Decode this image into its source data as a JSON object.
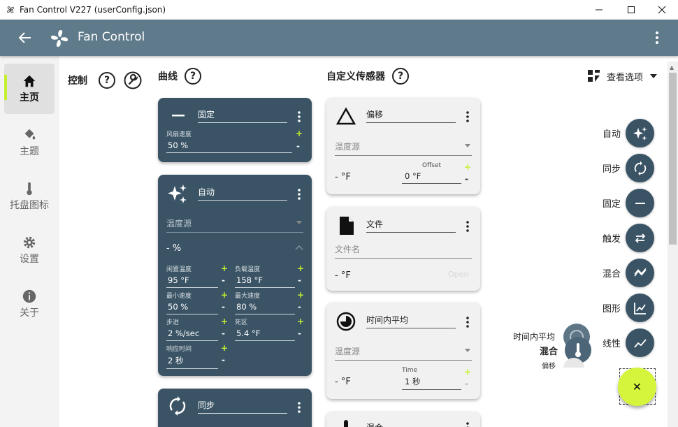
{
  "window": {
    "title": "Fan Control V227 (userConfig.json)"
  },
  "appbar": {
    "title": "Fan Control"
  },
  "rail": {
    "items": [
      {
        "label": "主页"
      },
      {
        "label": "主题"
      },
      {
        "label": "托盘图标"
      },
      {
        "label": "设置"
      },
      {
        "label": "关于"
      }
    ]
  },
  "sections": {
    "controls": "控制",
    "curves": "曲线",
    "custom_sensors": "自定义传感器",
    "help_glyph": "?"
  },
  "view_options": {
    "label": "查看选项"
  },
  "curves": {
    "fixed": {
      "name": "固定",
      "speed_label": "风扇速度",
      "speed_value": "50 %"
    },
    "auto": {
      "name": "自动",
      "temp_source_placeholder": "温度源",
      "reading": "- %",
      "fields": [
        {
          "label": "闲置温度",
          "value": "95 °F"
        },
        {
          "label": "负载温度",
          "value": "158 °F"
        },
        {
          "label": "最小速度",
          "value": "50 %"
        },
        {
          "label": "最大速度",
          "value": "80 %"
        },
        {
          "label": "步进",
          "value": "2 %/sec"
        },
        {
          "label": "死区",
          "value": "5.4 °F"
        },
        {
          "label": "响应时间",
          "value": "2 秒"
        }
      ]
    },
    "sync": {
      "name": "同步"
    }
  },
  "sensors": {
    "offset": {
      "name": "偏移",
      "temp_source_placeholder": "温度源",
      "reading": "- °F",
      "offset_label": "Offset",
      "offset_value": "0 °F"
    },
    "file": {
      "name": "文件",
      "file_placeholder": "文件名",
      "reading": "- °F",
      "open_label": "Open"
    },
    "time_average": {
      "name": "时间内平均",
      "temp_source_placeholder": "温度源",
      "reading": "- °F",
      "time_label": "Time",
      "time_value": "1 秒"
    },
    "mix": {
      "name": "混合"
    }
  },
  "speed_dial": {
    "items": [
      {
        "label": "自动",
        "icon": "sparkle-icon"
      },
      {
        "label": "同步",
        "icon": "sync-icon"
      },
      {
        "label": "固定",
        "icon": "minus-icon"
      },
      {
        "label": "触发",
        "icon": "swap-arrows-icon"
      },
      {
        "label": "混合",
        "icon": "mix-chart-icon"
      },
      {
        "label": "图形",
        "icon": "graph-icon"
      },
      {
        "label": "线性",
        "icon": "linear-icon"
      }
    ],
    "sensor_items": [
      {
        "label": "时间内平均"
      },
      {
        "label": "混合"
      },
      {
        "label": "偏移"
      }
    ],
    "close_glyph": "✕"
  },
  "colors": {
    "appbar": "#5f7a8a",
    "card": "#3a5466",
    "accent": "#c6f02e",
    "fab": "#d4f53c"
  }
}
